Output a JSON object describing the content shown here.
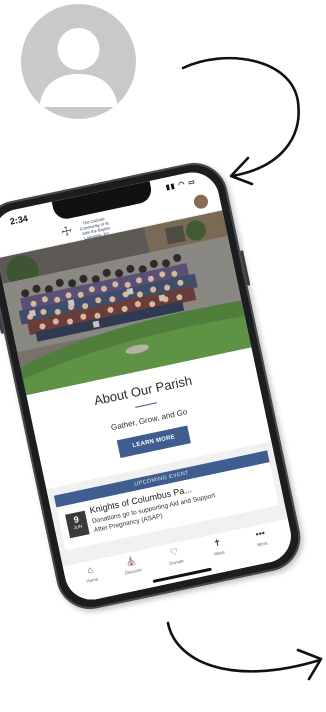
{
  "phone": {
    "status": {
      "time": "2:34",
      "icons": "▮▮ ◠ ▭"
    },
    "header": {
      "logo_text": "The Catholic Community of St. John the Baptist Lancaster, NY"
    },
    "about": {
      "title": "About Our Parish",
      "subtitle": "Gather, Grow, and Go",
      "button": "LEARN MORE"
    },
    "upcoming": {
      "label": "UPCOMING EVENT",
      "event": {
        "day": "9",
        "month": "JUN",
        "title": "Knights of Columbus Pa...",
        "description": "Donations go to supporting Aid and Support After Pregnancy (ASAP)"
      }
    },
    "tabs": [
      {
        "label": "Home",
        "icon": "home-icon"
      },
      {
        "label": "Discover",
        "icon": "discover-icon"
      },
      {
        "label": "Donate",
        "icon": "heart-icon"
      },
      {
        "label": "Mass",
        "icon": "cross-icon"
      },
      {
        "label": "More",
        "icon": "more-icon"
      }
    ]
  },
  "colors": {
    "accent": "#3f5d8e",
    "avatar_bg": "#c9c9c9",
    "phone_frame": "#1c1d1f"
  }
}
